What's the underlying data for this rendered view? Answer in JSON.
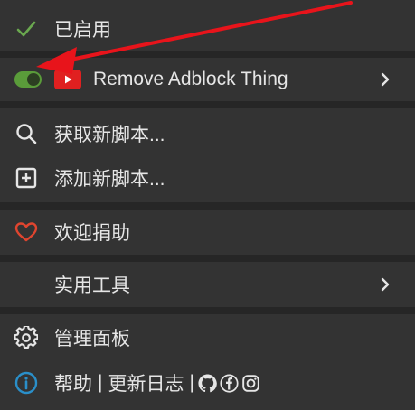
{
  "menu": {
    "enabled_label": "已启用",
    "script": {
      "name": "Remove Adblock Thing",
      "enabled": true,
      "toggle_color": "#5a9c3a",
      "site_icon": "youtube-icon",
      "site_icon_color": "#e02020"
    },
    "find_scripts_label": "获取新脚本...",
    "add_script_label": "添加新脚本...",
    "donate_label": "欢迎捐助",
    "utilities_label": "实用工具",
    "dashboard_label": "管理面板",
    "help_label": "帮助",
    "separator": "|",
    "changelog_label": "更新日志",
    "social_icons": [
      "github-icon",
      "facebook-icon",
      "instagram-icon"
    ]
  },
  "colors": {
    "background": "#333333",
    "separator": "#262626",
    "check": "#6aa84f",
    "heart": "#e0452f",
    "info": "#2a8fc9",
    "annotation_arrow": "#e8141b"
  }
}
